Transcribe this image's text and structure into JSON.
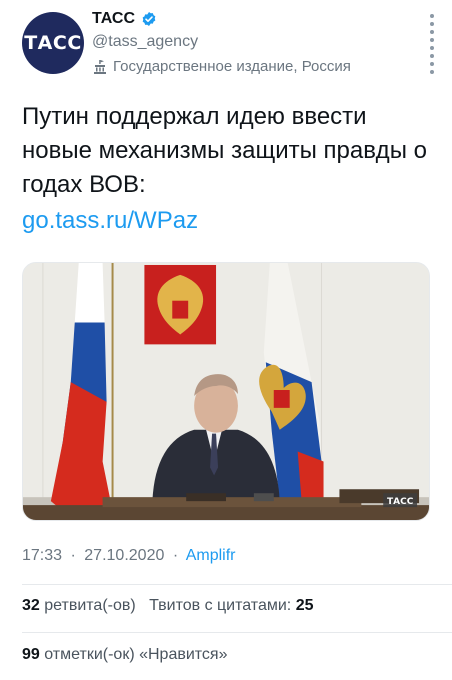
{
  "account": {
    "avatar_text": "ТАСС",
    "display_name": "ТАСС",
    "handle": "@tass_agency",
    "label": "Государственное издание, Россия"
  },
  "tweet": {
    "text": "Путин поддержал идею ввести новые механизмы защиты правды о годах ВОВ:",
    "link": "go.tass.ru/WPaz",
    "watermark": "ТАСС"
  },
  "meta": {
    "time": "17:33",
    "date": "27.10.2020",
    "separator": "·",
    "source": "Amplifr"
  },
  "stats": {
    "retweets_count": "32",
    "retweets_label": "ретвита(-ов)",
    "quotes_label": "Твитов с цитатами:",
    "quotes_count": "25",
    "likes_count": "99",
    "likes_label": "отметки(-ок) «Нравится»"
  },
  "colors": {
    "link": "#1d9bf0",
    "avatar_bg": "#1f2a5e",
    "muted_text": "#6b7680"
  }
}
